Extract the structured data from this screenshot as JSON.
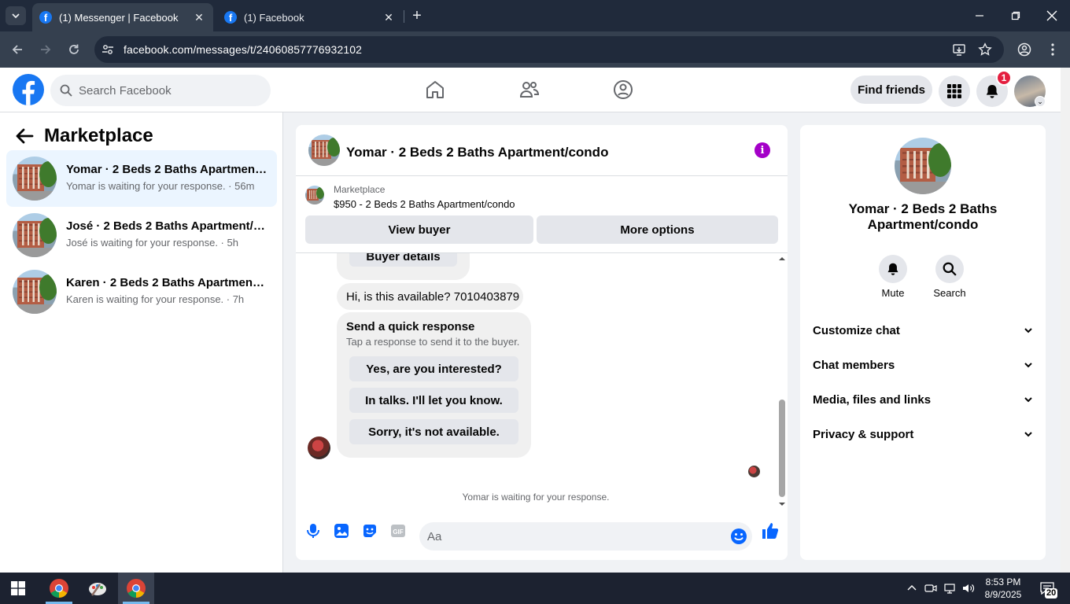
{
  "browser": {
    "tabs": [
      {
        "title": "(1) Messenger | Facebook",
        "active": true
      },
      {
        "title": "(1) Facebook",
        "active": false
      }
    ],
    "url": "facebook.com/messages/t/24060857776932102"
  },
  "header": {
    "search_placeholder": "Search Facebook",
    "find_friends": "Find friends",
    "notification_count": "1"
  },
  "sidebar": {
    "title": "Marketplace",
    "conversations": [
      {
        "name": "Yomar · 2 Beds 2 Baths Apartment/condo",
        "preview": "Yomar is waiting for your response. · 56m",
        "selected": true
      },
      {
        "name": "José · 2 Beds 2 Baths Apartment/condo",
        "preview": "José is waiting for your response. · 5h",
        "selected": false
      },
      {
        "name": "Karen · 2 Beds 2 Baths Apartment/condo",
        "preview": "Karen is waiting for your response. · 7h",
        "selected": false
      }
    ]
  },
  "chat": {
    "title": "Yomar · 2 Beds 2 Baths Apartment/condo",
    "marketplace_label": "Marketplace",
    "listing": "$950 - 2 Beds 2 Baths Apartment/condo",
    "view_buyer": "View buyer",
    "more_options": "More options",
    "buyer_details": "Buyer details",
    "message": "Hi, is this available? 7010403879",
    "quick_title": "Send a quick response",
    "quick_subtitle": "Tap a response to send it to the buyer.",
    "quick_responses": [
      "Yes, are you interested?",
      "In talks. I'll let you know.",
      "Sorry, it's not available."
    ],
    "waiting": "Yomar is waiting for your response.",
    "composer_placeholder": "Aa"
  },
  "info": {
    "name": "Yomar · 2 Beds 2 Baths Apartment/condo",
    "mute": "Mute",
    "search": "Search",
    "sections": [
      "Customize chat",
      "Chat members",
      "Media, files and links",
      "Privacy & support"
    ]
  },
  "taskbar": {
    "time": "8:53 PM",
    "date": "8/9/2025",
    "notifications": "20"
  },
  "colors": {
    "brand": "#1877f2",
    "selected_row": "#ebf5ff",
    "info_icon": "#a400c8",
    "badge": "#e41e3f"
  }
}
